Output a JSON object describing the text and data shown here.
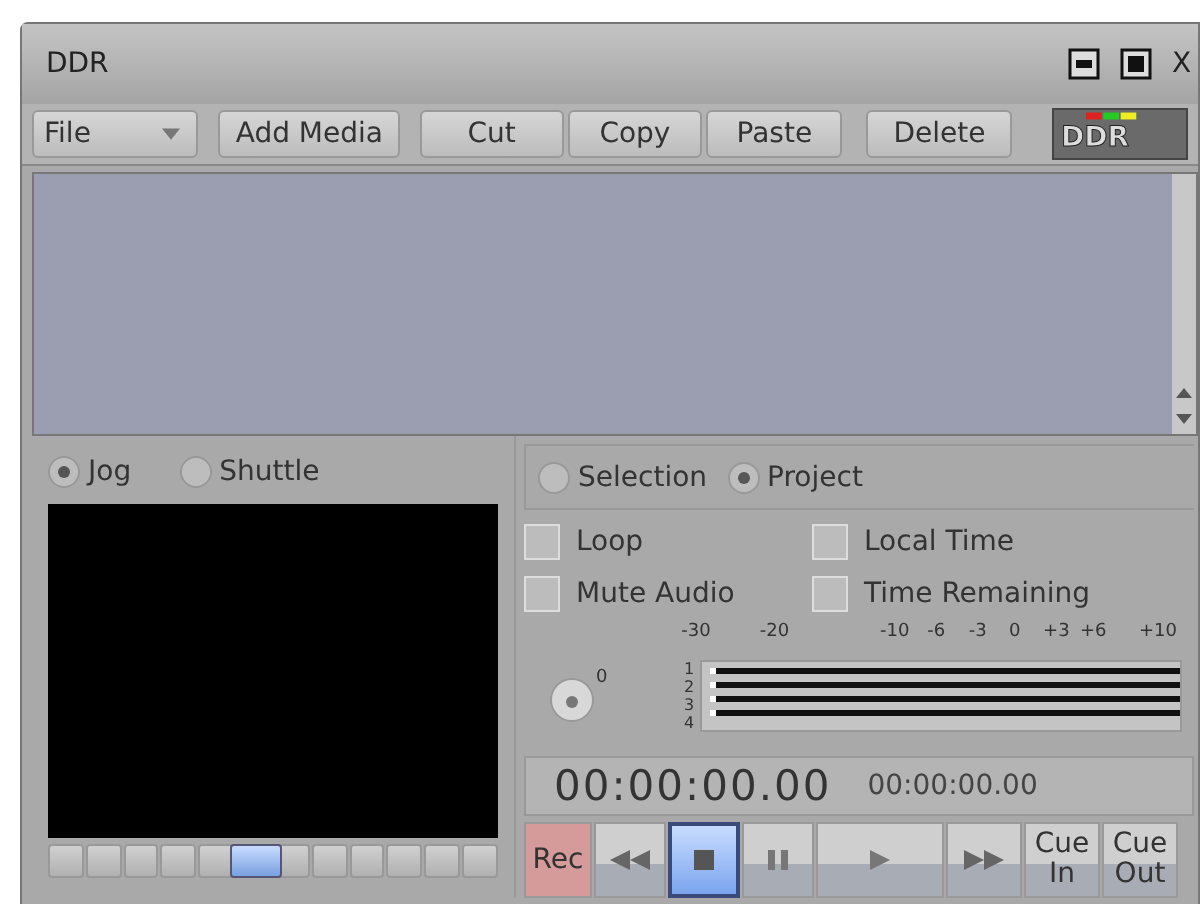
{
  "window": {
    "title": "DDR",
    "close_label": "X"
  },
  "toolbar": {
    "file_menu": "File",
    "buttons": [
      "Add Media",
      "Cut",
      "Copy",
      "Paste",
      "Delete"
    ],
    "logo": "DDR"
  },
  "scrub_mode": [
    {
      "label": "Jog",
      "selected": true
    },
    {
      "label": "Shuttle",
      "selected": false
    }
  ],
  "jog_slider": {
    "level": 0.46
  },
  "range": [
    {
      "label": "Selection",
      "selected": false
    },
    {
      "label": "Project",
      "selected": true
    }
  ],
  "options": [
    {
      "label": "Loop",
      "checked": false
    },
    {
      "label": "Local Time",
      "checked": false
    },
    {
      "label": "Mute Audio",
      "checked": false
    },
    {
      "label": "Time Remaining",
      "checked": false
    }
  ],
  "level_knob": {
    "label": "0"
  },
  "meter": {
    "scale": [
      "-30",
      "-20",
      "-10",
      "-6",
      "-3",
      "0",
      "+3",
      "+6",
      "+10"
    ],
    "channels": [
      "1",
      "2",
      "3",
      "4"
    ]
  },
  "timecode": {
    "main": "00:00:00.00",
    "secondary": "00:00:00.00"
  },
  "transport": [
    {
      "kind": "rec",
      "label": "Rec",
      "selected": false
    },
    {
      "kind": "rewind",
      "selected": false
    },
    {
      "kind": "stop",
      "selected": true
    },
    {
      "kind": "pause",
      "selected": false
    },
    {
      "kind": "play",
      "selected": false
    },
    {
      "kind": "forward",
      "selected": false
    },
    {
      "kind": "text",
      "label": "Cue In",
      "selected": false
    },
    {
      "kind": "text",
      "label": "Cue Out",
      "selected": false
    }
  ]
}
